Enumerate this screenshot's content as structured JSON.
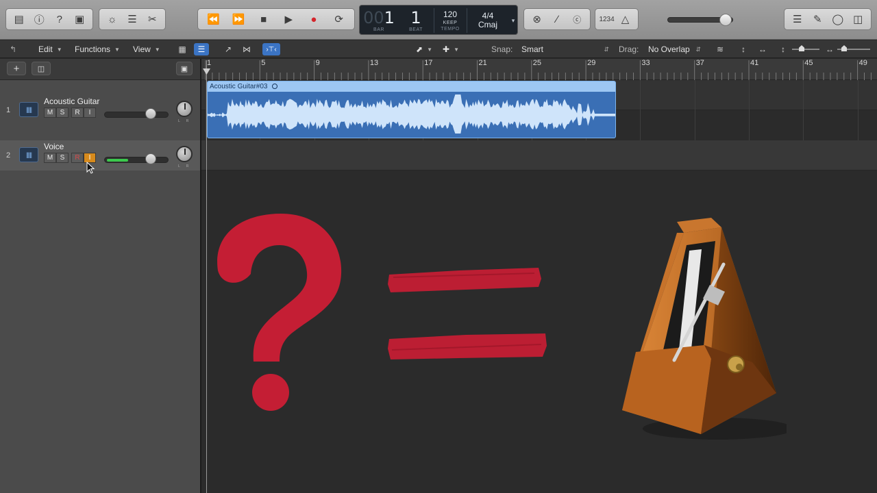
{
  "lcd": {
    "bar_dim": "00",
    "bar": "1",
    "beat": "1",
    "bar_caption": "BAR",
    "beat_caption": "BEAT",
    "tempo": "120",
    "tempo_mode": "KEEP",
    "tempo_caption": "TEMPO",
    "signature": "4/4",
    "key": "Cmaj"
  },
  "control_icons": {
    "count_in": "1234"
  },
  "tracks_bar": {
    "edit": "Edit",
    "functions": "Functions",
    "view": "View",
    "snap_label": "Snap:",
    "snap_value": "Smart",
    "drag_label": "Drag:",
    "drag_value": "No Overlap"
  },
  "ruler": {
    "bars": [
      "1",
      "5",
      "9",
      "13",
      "17",
      "21",
      "25",
      "29",
      "33",
      "37",
      "41",
      "45",
      "49"
    ]
  },
  "tracks": [
    {
      "number": "1",
      "name": "Acoustic Guitar",
      "mute": "M",
      "solo": "S",
      "record": "R",
      "input": "I",
      "volume_level": 0.72,
      "meter_level": 0.0
    },
    {
      "number": "2",
      "name": "Voice",
      "mute": "M",
      "solo": "S",
      "record": "R",
      "input": "I",
      "volume_level": 0.72,
      "meter_level": 0.33
    }
  ],
  "region": {
    "name": "Acoustic Guitar#03"
  },
  "colors": {
    "accent": "#3b74c4",
    "region_body": "#3a6fb5",
    "region_header": "#9dc7f3",
    "question_mark": "#c41e34",
    "equals_sign": "#c41e34",
    "metronome_wood": "#a4581a"
  },
  "overlay": {
    "question_icon": "question-mark-icon",
    "equals_icon": "equals-sign-icon",
    "metronome_icon": "metronome-icon"
  }
}
